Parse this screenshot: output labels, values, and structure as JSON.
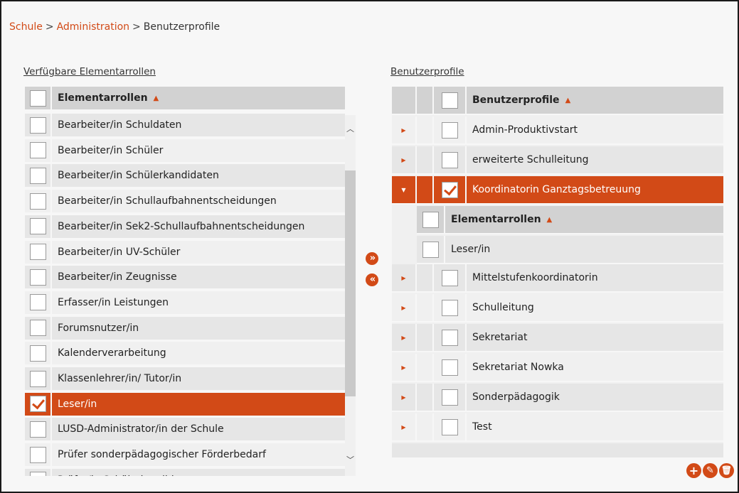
{
  "breadcrumb": {
    "items": [
      "Schule",
      "Administration"
    ],
    "separator": ">",
    "current": "Benutzerprofile"
  },
  "left_panel": {
    "title": "Verfügbare Elementarrollen",
    "header": "Elementarrollen",
    "rows": [
      {
        "label": "Bearbeiter/in Schuldaten",
        "checked": false
      },
      {
        "label": "Bearbeiter/in Schüler",
        "checked": false
      },
      {
        "label": "Bearbeiter/in Schülerkandidaten",
        "checked": false
      },
      {
        "label": "Bearbeiter/in Schullaufbahnentscheidungen",
        "checked": false
      },
      {
        "label": "Bearbeiter/in Sek2-Schullaufbahnentscheidungen",
        "checked": false
      },
      {
        "label": "Bearbeiter/in UV-Schüler",
        "checked": false
      },
      {
        "label": "Bearbeiter/in Zeugnisse",
        "checked": false
      },
      {
        "label": "Erfasser/in Leistungen",
        "checked": false
      },
      {
        "label": "Forumsnutzer/in",
        "checked": false
      },
      {
        "label": "Kalenderverarbeitung",
        "checked": false
      },
      {
        "label": "Klassenlehrer/in/ Tutor/in",
        "checked": false
      },
      {
        "label": "Leser/in",
        "checked": true
      },
      {
        "label": "LUSD-Administrator/in der Schule",
        "checked": false
      },
      {
        "label": "Prüfer sonderpädagogischer Förderbedarf",
        "checked": false
      },
      {
        "label": "Prüfer/in Schülerkandidaten",
        "checked": false
      }
    ]
  },
  "right_panel": {
    "title": "Benutzerprofile",
    "header": "Benutzerprofile",
    "rows": [
      {
        "label": "Admin-Produktivstart",
        "checked": false,
        "expanded": false
      },
      {
        "label": "erweiterte Schulleitung",
        "checked": false,
        "expanded": false
      },
      {
        "label": "Koordinatorin Ganztagsbetreuung",
        "checked": true,
        "expanded": true
      },
      {
        "label": "Mittelstufenkoordinatorin",
        "checked": false,
        "expanded": false
      },
      {
        "label": "Schulleitung",
        "checked": false,
        "expanded": false
      },
      {
        "label": "Sekretariat",
        "checked": false,
        "expanded": false
      },
      {
        "label": "Sekretariat Nowka",
        "checked": false,
        "expanded": false
      },
      {
        "label": "Sonderpädagogik",
        "checked": false,
        "expanded": false
      },
      {
        "label": "Test",
        "checked": false,
        "expanded": false
      }
    ],
    "nested": {
      "header": "Elementarrollen",
      "rows": [
        {
          "label": "Leser/in",
          "checked": false
        }
      ]
    }
  },
  "icons": {
    "sort": "sort-ascending-icon",
    "expand": "triangle-right-icon",
    "collapse": "triangle-down-icon",
    "add_to_right": "double-chevron-right-icon",
    "add_to_left": "double-chevron-left-icon",
    "add": "plus-circle-icon",
    "edit": "pencil-circle-icon",
    "delete": "trash-circle-icon"
  },
  "colors": {
    "accent": "#d24a17",
    "header_bg": "#d2d2d2",
    "row_bg": "#e6e6e6"
  }
}
